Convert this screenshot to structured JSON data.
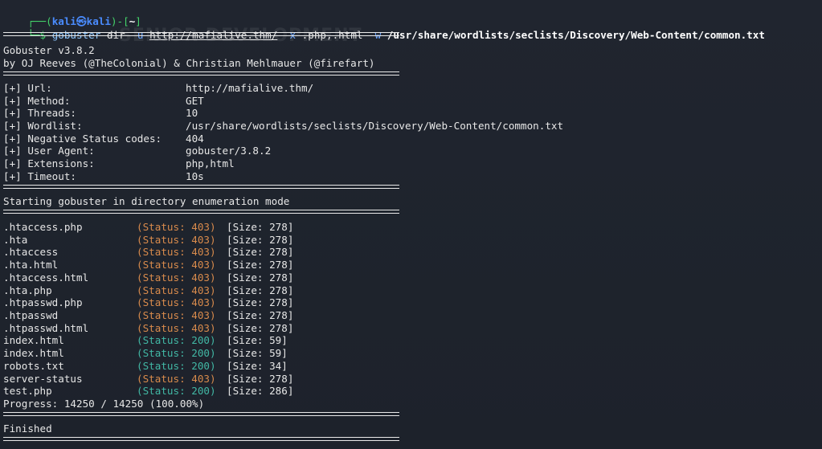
{
  "prompt": {
    "corner": "┌──(",
    "user_host": "kali㉿kali",
    "mid": ")-[",
    "dir": "~",
    "end": "]",
    "arrow": "└─$"
  },
  "command": {
    "program": "gobuster",
    "sub": "dir",
    "flag_u": "-u",
    "url": "http://mafialive.thm/",
    "flag_x": "-x",
    "extensions": ".php,.html",
    "flag_w": "-w",
    "wordlist": "/usr/share/wordlists/seclists/Discovery/Web-Content/common.txt"
  },
  "banner": {
    "title": "Gobuster v3.8.2",
    "credits": "by OJ Reeves (@TheColonial) & Christian Mehlmauer (@firefart)"
  },
  "config": [
    {
      "key": "[+] Url:",
      "value": "http://mafialive.thm/"
    },
    {
      "key": "[+] Method:",
      "value": "GET"
    },
    {
      "key": "[+] Threads:",
      "value": "10"
    },
    {
      "key": "[+] Wordlist:",
      "value": "/usr/share/wordlists/seclists/Discovery/Web-Content/common.txt"
    },
    {
      "key": "[+] Negative Status codes:",
      "value": "404"
    },
    {
      "key": "[+] User Agent:",
      "value": "gobuster/3.8.2"
    },
    {
      "key": "[+] Extensions:",
      "value": "php,html"
    },
    {
      "key": "[+] Timeout:",
      "value": "10s"
    }
  ],
  "start_message": "Starting gobuster in directory enumeration mode",
  "results": [
    {
      "path": ".htaccess.php",
      "status_label": "(Status: 403)",
      "code": "403",
      "size": "[Size: 278]"
    },
    {
      "path": ".hta",
      "status_label": "(Status: 403)",
      "code": "403",
      "size": "[Size: 278]"
    },
    {
      "path": ".htaccess",
      "status_label": "(Status: 403)",
      "code": "403",
      "size": "[Size: 278]"
    },
    {
      "path": ".hta.html",
      "status_label": "(Status: 403)",
      "code": "403",
      "size": "[Size: 278]"
    },
    {
      "path": ".htaccess.html",
      "status_label": "(Status: 403)",
      "code": "403",
      "size": "[Size: 278]"
    },
    {
      "path": ".hta.php",
      "status_label": "(Status: 403)",
      "code": "403",
      "size": "[Size: 278]"
    },
    {
      "path": ".htpasswd.php",
      "status_label": "(Status: 403)",
      "code": "403",
      "size": "[Size: 278]"
    },
    {
      "path": ".htpasswd",
      "status_label": "(Status: 403)",
      "code": "403",
      "size": "[Size: 278]"
    },
    {
      "path": ".htpasswd.html",
      "status_label": "(Status: 403)",
      "code": "403",
      "size": "[Size: 278]"
    },
    {
      "path": "index.html",
      "status_label": "(Status: 200)",
      "code": "200",
      "size": "[Size: 59]"
    },
    {
      "path": "index.html",
      "status_label": "(Status: 200)",
      "code": "200",
      "size": "[Size: 59]"
    },
    {
      "path": "robots.txt",
      "status_label": "(Status: 200)",
      "code": "200",
      "size": "[Size: 34]"
    },
    {
      "path": "server-status",
      "status_label": "(Status: 403)",
      "code": "403",
      "size": "[Size: 278]"
    },
    {
      "path": "test.php",
      "status_label": "(Status: 200)",
      "code": "200",
      "size": "[Size: 286]"
    }
  ],
  "progress": "Progress: 14250 / 14250 (100.00%)",
  "finished": "Finished",
  "colors": {
    "status_403": "#d98b4c",
    "status_200": "#42b8a5",
    "prompt_green": "#44d36a",
    "prompt_blue": "#4a8cff"
  }
}
